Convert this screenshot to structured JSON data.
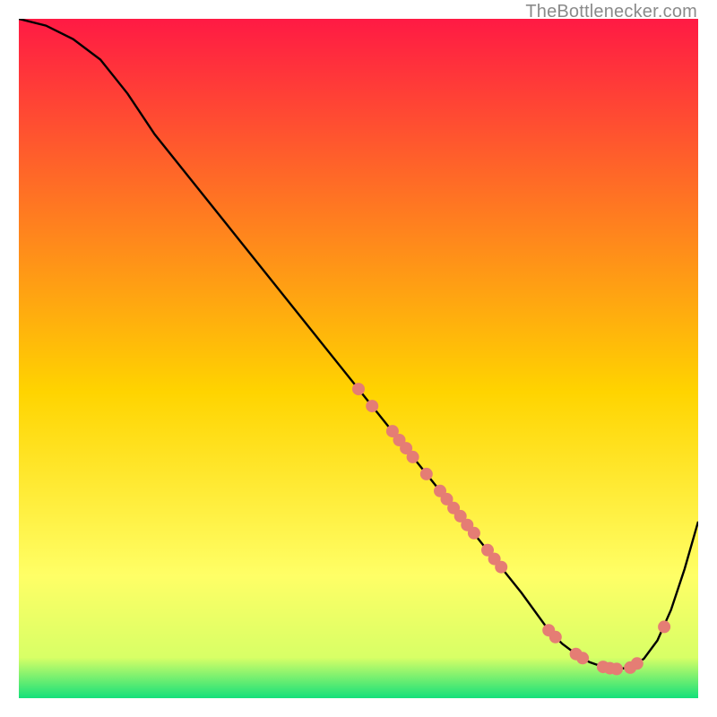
{
  "watermark": "TheBottlenecker.com",
  "chart_data": {
    "type": "line",
    "title": "",
    "xlabel": "",
    "ylabel": "",
    "xlim": [
      0,
      100
    ],
    "ylim": [
      0,
      100
    ],
    "background_gradient": {
      "top": "#ff1a44",
      "mid1": "#ffd400",
      "mid2": "#ffff66",
      "bottom": "#14e07a"
    },
    "series": [
      {
        "name": "curve",
        "color": "#000000",
        "x": [
          0,
          4,
          8,
          12,
          16,
          20,
          26,
          32,
          38,
          44,
          50,
          56,
          62,
          68,
          74,
          78,
          80,
          82,
          84,
          86,
          88,
          90,
          92,
          94,
          96,
          98,
          100
        ],
        "y": [
          100,
          99,
          97,
          94,
          89,
          83,
          75.5,
          68,
          60.5,
          53,
          45.5,
          38,
          30.5,
          23,
          15.5,
          10,
          8,
          6.5,
          5.3,
          4.6,
          4.3,
          4.5,
          5.8,
          8.5,
          13,
          19,
          26
        ]
      }
    ],
    "scatter_points": {
      "name": "dots",
      "color": "#e57d74",
      "radius": 7,
      "points": [
        {
          "x": 50,
          "y": 45.5
        },
        {
          "x": 52,
          "y": 43
        },
        {
          "x": 55,
          "y": 39.3
        },
        {
          "x": 56,
          "y": 38
        },
        {
          "x": 57,
          "y": 36.8
        },
        {
          "x": 58,
          "y": 35.5
        },
        {
          "x": 60,
          "y": 33
        },
        {
          "x": 62,
          "y": 30.5
        },
        {
          "x": 63,
          "y": 29.3
        },
        {
          "x": 64,
          "y": 28
        },
        {
          "x": 65,
          "y": 26.8
        },
        {
          "x": 66,
          "y": 25.5
        },
        {
          "x": 67,
          "y": 24.3
        },
        {
          "x": 69,
          "y": 21.8
        },
        {
          "x": 70,
          "y": 20.5
        },
        {
          "x": 71,
          "y": 19.3
        },
        {
          "x": 78,
          "y": 10
        },
        {
          "x": 79,
          "y": 9
        },
        {
          "x": 82,
          "y": 6.5
        },
        {
          "x": 83,
          "y": 5.9
        },
        {
          "x": 86,
          "y": 4.6
        },
        {
          "x": 87,
          "y": 4.4
        },
        {
          "x": 88,
          "y": 4.3
        },
        {
          "x": 90,
          "y": 4.5
        },
        {
          "x": 91,
          "y": 5.1
        },
        {
          "x": 95,
          "y": 10.5
        }
      ]
    }
  }
}
